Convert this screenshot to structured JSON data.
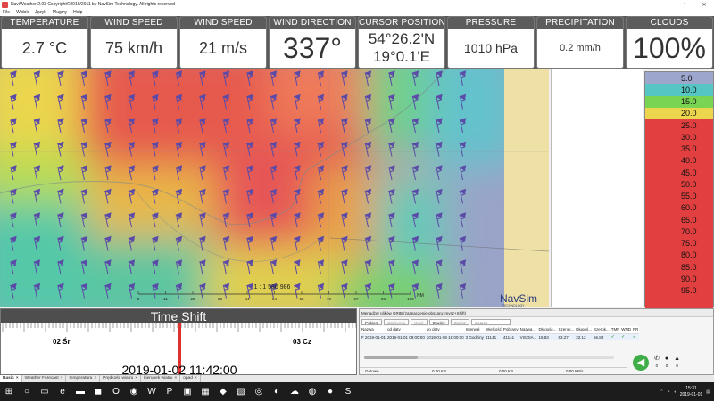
{
  "window": {
    "title": "NaviWeather 2.03 Copyright©2010/2011 by NavSim Technology. All rights reserved",
    "minimize": "–",
    "maximize": "▫",
    "close": "✕"
  },
  "menu": [
    "File",
    "Widok",
    "Język",
    "Pluginy",
    "Help"
  ],
  "panels": [
    {
      "label": "TEMPERATURE",
      "value": "2.7 °C",
      "size": "normal"
    },
    {
      "label": "WIND SPEED",
      "value": "75 km/h",
      "size": "normal"
    },
    {
      "label": "WIND SPEED",
      "value": "21 m/s",
      "size": "normal"
    },
    {
      "label": "WIND DIRECTION",
      "value": "337°",
      "size": "big"
    },
    {
      "label": "CURSOR POSITION",
      "value": "54°26.2'N",
      "value2": "19°0.1'E",
      "size": "two"
    },
    {
      "label": "PRESSURE",
      "value": "1010 hPa",
      "size": "med"
    },
    {
      "label": "PRECIPITATION",
      "value": "0.2 mm/h",
      "size": "sm"
    },
    {
      "label": "CLOUDS",
      "value": "100%",
      "size": "big"
    }
  ],
  "map": {
    "scale_text": "1 : 1 586 986",
    "scale_ticks": [
      "0",
      "11",
      "22",
      "33",
      "44",
      "54",
      "65",
      "76",
      "87",
      "98",
      "109"
    ],
    "scale_unit": "NM",
    "logo": "NavSim",
    "logo_sub": "TECHNOLOGY"
  },
  "legend": [
    {
      "label": "5.0",
      "color": "#9da6cc"
    },
    {
      "label": "10.0",
      "color": "#56c6c4"
    },
    {
      "label": "15.0",
      "color": "#7ad454"
    },
    {
      "label": "20.0",
      "color": "#ebd64e"
    },
    {
      "label": "25.0",
      "color": "#e24040"
    },
    {
      "label": "30.0",
      "color": "#e24040"
    },
    {
      "label": "35.0",
      "color": "#e24040"
    },
    {
      "label": "40.0",
      "color": "#e24040"
    },
    {
      "label": "45.0",
      "color": "#e24040"
    },
    {
      "label": "50.0",
      "color": "#e24040"
    },
    {
      "label": "55.0",
      "color": "#e24040"
    },
    {
      "label": "60.0",
      "color": "#e24040"
    },
    {
      "label": "65.0",
      "color": "#e24040"
    },
    {
      "label": "70.0",
      "color": "#e24040"
    },
    {
      "label": "75.0",
      "color": "#e24040"
    },
    {
      "label": "80.0",
      "color": "#e24040"
    },
    {
      "label": "85.0",
      "color": "#e24040"
    },
    {
      "label": "90.0",
      "color": "#e24040"
    },
    {
      "label": "95.0",
      "color": "#e24040"
    },
    {
      "label": "",
      "color": "#e24040"
    }
  ],
  "timeshift": {
    "title": "Time Shift",
    "left_day": "02 Śr",
    "right_day": "03 Cz",
    "current_time": "2019-01-02 11:42:00"
  },
  "grib": {
    "title": "Menadżer plików GRIB (zaznaczenie obszaru: mysz+Shift)",
    "buttons": [
      {
        "label": "Pobierz",
        "disabled": false
      },
      {
        "label": "Zatrzymaj",
        "disabled": true
      },
      {
        "label": "Usuń",
        "disabled": true
      },
      {
        "label": "Otwórz",
        "disabled": false
      },
      {
        "label": "Zapisz",
        "disabled": true
      }
    ],
    "search_placeholder": "Search",
    "columns": [
      "Nazwa",
      "od daty",
      "do daty",
      "Interwał",
      "Wielkość",
      "Pobrany",
      "Nazwa...",
      "Długośc...",
      "Szerok...",
      "Długoś...",
      "Szerok...",
      "TMP",
      "WND",
      "PR"
    ],
    "rows": [
      [
        "F 2019-01-01",
        "2019-01-01 09:00:00",
        "2019-01-08 18:00:00",
        "3 Godziny",
        "41141",
        "41141",
        "VISOIA...",
        "15.83",
        "53.27",
        "22.12",
        "56.83",
        "✓",
        "✓",
        "✓"
      ]
    ],
    "status": [
      "Gotowe",
      "0.00 KB",
      "0.00 KB",
      "0.00 KB/s"
    ],
    "nav_arrow": "◀",
    "phone_count": "0",
    "chat_count": "0",
    "bell_count": "0"
  },
  "tabs": [
    {
      "label": "Basic",
      "active": true
    },
    {
      "label": "Weather Forecast",
      "active": false
    },
    {
      "label": "temperatura",
      "active": false
    },
    {
      "label": "Prędkość wiatru",
      "active": false
    },
    {
      "label": "kierunek wiatru",
      "active": false
    },
    {
      "label": "opad",
      "active": false
    }
  ],
  "taskbar": {
    "time": "15:31",
    "date": "2019-01-01"
  },
  "colors": {
    "panel_header": "#5c5c5c",
    "accent_green": "#3fae49",
    "timeshift_cursor": "#e03030",
    "wind_barb": "#5b4aa8"
  }
}
